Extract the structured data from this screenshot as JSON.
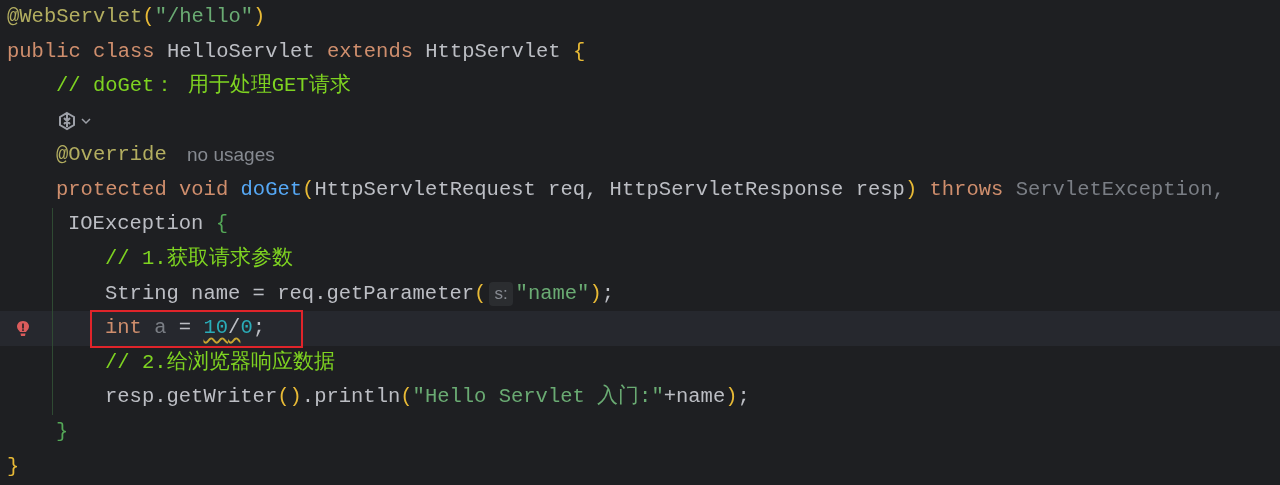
{
  "lines": [
    {
      "kind": "top",
      "tokens": [
        {
          "kind": "annotation",
          "text": "@WebServlet"
        },
        {
          "kind": "gold",
          "text": "("
        },
        {
          "kind": "string",
          "text": "\"/hello\""
        },
        {
          "kind": "gold",
          "text": ")"
        }
      ]
    },
    {
      "kind": "top",
      "tokens": [
        {
          "kind": "keyword",
          "text": "public class"
        },
        {
          "kind": "plain",
          "text": "HelloServlet"
        },
        {
          "kind": "keyword",
          "text": "extends"
        },
        {
          "kind": "plain",
          "text": "HttpServlet"
        },
        {
          "kind": "gold",
          "text": "{"
        }
      ]
    },
    {
      "kind": "member",
      "tokens": [
        {
          "kind": "comment",
          "text": "// doGet： 用于处理GET请求"
        }
      ]
    },
    {
      "kind": "member",
      "tokens": [
        {
          "kind": "ai-icon"
        }
      ]
    },
    {
      "kind": "member",
      "tokens": [
        {
          "kind": "annotation",
          "text": "@Override"
        },
        {
          "kind": "hint",
          "text": "no usages"
        }
      ]
    },
    {
      "kind": "member",
      "tokens": [
        {
          "kind": "keyword",
          "text": "protected void"
        },
        {
          "kind": "method",
          "text": "doGet"
        },
        {
          "kind": "gold",
          "text": "("
        },
        {
          "kind": "plain",
          "text": "HttpServletRequest req, HttpServletResponse resp"
        },
        {
          "kind": "gold",
          "text": ")"
        },
        {
          "kind": "keyword",
          "text": "throws"
        },
        {
          "kind": "muted",
          "text": "ServletException,"
        }
      ]
    },
    {
      "kind": "continuation",
      "tokens": [
        {
          "kind": "plain",
          "text": "IOException"
        },
        {
          "kind": "green",
          "text": "{"
        }
      ]
    },
    {
      "kind": "body",
      "tokens": [
        {
          "kind": "comment",
          "text": "// 1.获取请求参数"
        }
      ]
    },
    {
      "kind": "body",
      "tokens": [
        {
          "kind": "plain",
          "text": "String name = req.getParameter"
        },
        {
          "kind": "gold",
          "text": "("
        },
        {
          "kind": "param-hint",
          "text": "s:"
        },
        {
          "kind": "string",
          "text": "\"name\""
        },
        {
          "kind": "gold",
          "text": ")"
        },
        {
          "kind": "plain",
          "text": ";"
        }
      ]
    },
    {
      "kind": "body",
      "highlighted": true,
      "error_marker": true,
      "boxed": true,
      "tokens": [
        {
          "kind": "keyword",
          "text": "int"
        },
        {
          "kind": "muted",
          "text": "a"
        },
        {
          "kind": "plain",
          "text": "="
        },
        {
          "kind": "number",
          "text": "10",
          "warning": true
        },
        {
          "kind": "plain",
          "text": "/",
          "warning": true
        },
        {
          "kind": "number",
          "text": "0"
        },
        {
          "kind": "plain",
          "text": ";"
        }
      ]
    },
    {
      "kind": "body",
      "tokens": [
        {
          "kind": "comment",
          "text": "// 2.给浏览器响应数据"
        }
      ]
    },
    {
      "kind": "body",
      "tokens": [
        {
          "kind": "plain",
          "text": "resp.getWriter"
        },
        {
          "kind": "gold",
          "text": "()"
        },
        {
          "kind": "plain",
          "text": ".println"
        },
        {
          "kind": "gold",
          "text": "("
        },
        {
          "kind": "string",
          "text": "\"Hello Servlet 入门:\""
        },
        {
          "kind": "plain",
          "text": "+name"
        },
        {
          "kind": "gold",
          "text": ")"
        },
        {
          "kind": "plain",
          "text": ";"
        }
      ]
    },
    {
      "kind": "member-close",
      "tokens": [
        {
          "kind": "green",
          "text": "}"
        }
      ]
    },
    {
      "kind": "top",
      "tokens": [
        {
          "kind": "gold",
          "text": "}"
        }
      ]
    }
  ]
}
